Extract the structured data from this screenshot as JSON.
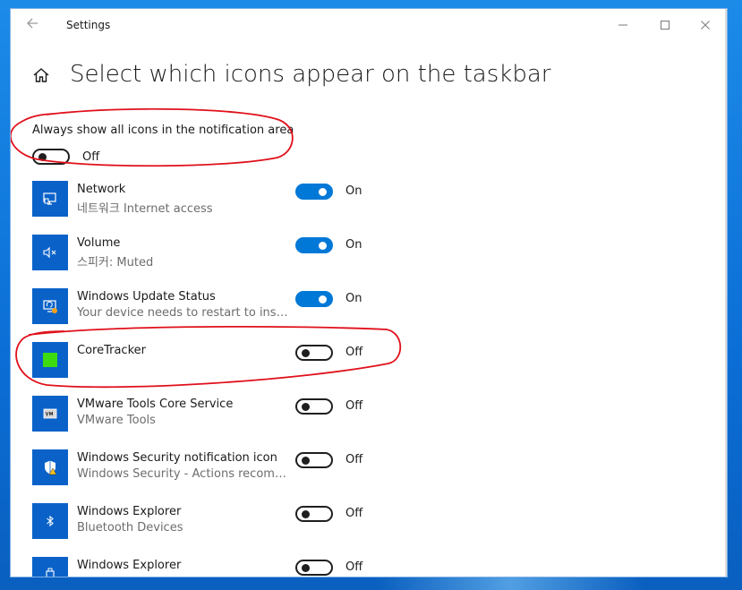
{
  "window": {
    "title": "Settings"
  },
  "page": {
    "title": "Select which icons appear on the taskbar"
  },
  "always_show": {
    "label": "Always show all icons in the notification area",
    "state": "Off"
  },
  "apps": [
    {
      "name": "Network",
      "subtitle": "네트워크 Internet access",
      "state": "On",
      "icon": "monitor-network-icon"
    },
    {
      "name": "Volume",
      "subtitle": "스피커: Muted",
      "state": "On",
      "icon": "speaker-muted-icon"
    },
    {
      "name": "Windows Update Status",
      "subtitle": "Your device needs to restart to insta...",
      "state": "On",
      "icon": "windows-update-icon"
    },
    {
      "name": "CoreTracker",
      "subtitle": "",
      "state": "Off",
      "icon": "green-square-icon"
    },
    {
      "name": "VMware Tools Core Service",
      "subtitle": "VMware Tools",
      "state": "Off",
      "icon": "vmware-icon"
    },
    {
      "name": "Windows Security notification icon",
      "subtitle": "Windows Security - Actions recomm...",
      "state": "Off",
      "icon": "shield-warning-icon"
    },
    {
      "name": "Windows Explorer",
      "subtitle": "Bluetooth Devices",
      "state": "Off",
      "icon": "bluetooth-icon"
    },
    {
      "name": "Windows Explorer",
      "subtitle": "",
      "state": "Off",
      "icon": "usb-eject-icon"
    }
  ],
  "colors": {
    "accent": "#0078d7",
    "tile": "#0a62c9",
    "annotation": "#e0101a",
    "coretracker": "#3cdc10"
  }
}
